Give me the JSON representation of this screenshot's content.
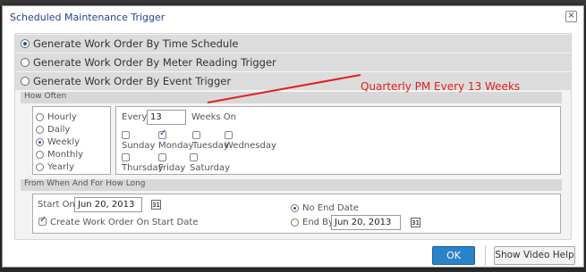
{
  "dialog": {
    "title": "Scheduled Maintenance Trigger",
    "close_symbol": "×"
  },
  "options": [
    {
      "label": "Generate Work Order By Time Schedule",
      "selected": true
    },
    {
      "label": "Generate Work Order By Meter Reading Trigger",
      "selected": false
    },
    {
      "label": "Generate Work Order By Event Trigger",
      "selected": false
    }
  ],
  "how_often": {
    "header": "How Often",
    "frequencies": [
      {
        "label": "Hourly",
        "selected": false
      },
      {
        "label": "Daily",
        "selected": false
      },
      {
        "label": "Weekly",
        "selected": true
      },
      {
        "label": "Monthly",
        "selected": false
      },
      {
        "label": "Yearly",
        "selected": false
      }
    ],
    "every_label": "Every",
    "every_value": "13",
    "weeks_on_label": "Weeks On",
    "days": [
      {
        "label": "Sunday",
        "checked": false
      },
      {
        "label": "Monday",
        "checked": true
      },
      {
        "label": "Tuesday",
        "checked": false
      },
      {
        "label": "Wednesday",
        "checked": false
      },
      {
        "label": "Thursday",
        "checked": false
      },
      {
        "label": "Friday",
        "checked": false
      },
      {
        "label": "Saturday",
        "checked": false
      }
    ]
  },
  "from_when": {
    "header": "From When And For How Long",
    "start_on_label": "Start On",
    "start_on_value": "Jun 20, 2013",
    "create_on_start_label": "Create Work Order On Start Date",
    "create_on_start_checked": true,
    "no_end_label": "No End Date",
    "no_end_selected": true,
    "end_by_label": "End By",
    "end_by_value": "Jun 20, 2013",
    "end_by_selected": false
  },
  "footer": {
    "ok_label": "OK",
    "help_label": "Show Video Help"
  },
  "annotation": {
    "text": "Quarterly PM Every 13 Weeks",
    "color": "#e02020"
  },
  "colors": {
    "primary_button": "#2a82c8",
    "title_text": "#23448a"
  }
}
